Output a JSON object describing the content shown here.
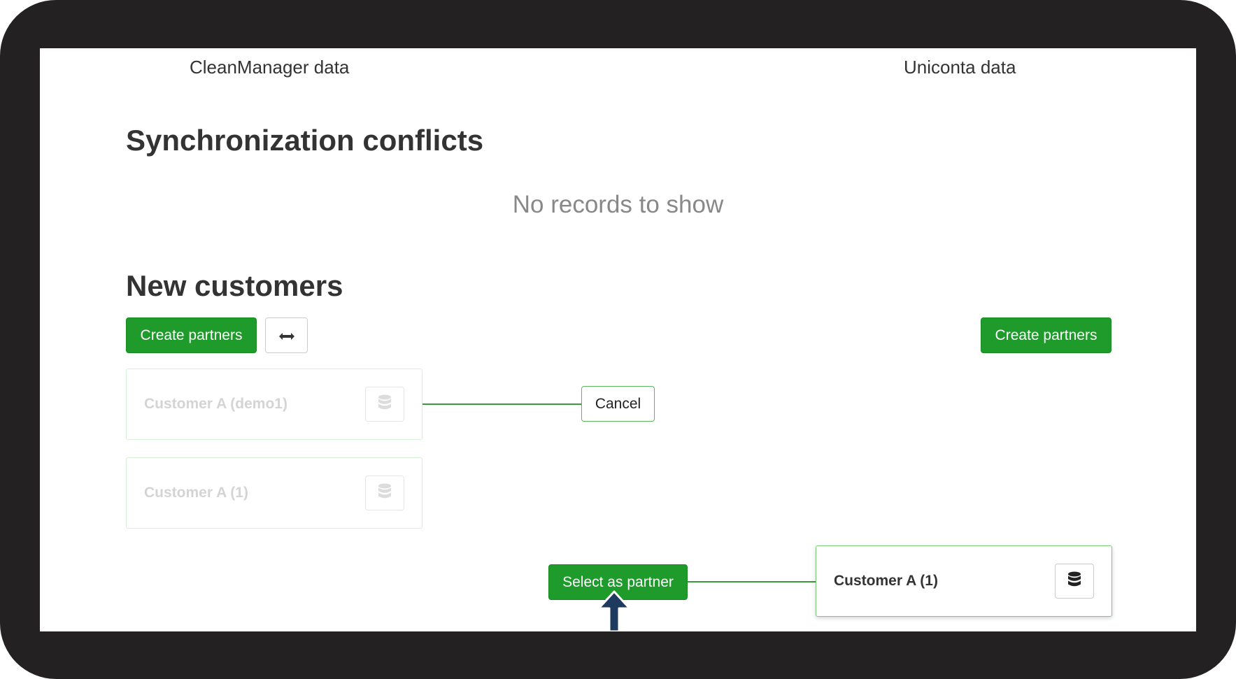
{
  "columns": {
    "left_header": "CleanManager data",
    "right_header": "Uniconta data"
  },
  "conflicts": {
    "title": "Synchronization conflicts",
    "empty_message": "No records to show"
  },
  "new_customers": {
    "title": "New customers",
    "create_partners_left_label": "Create partners",
    "create_partners_right_label": "Create partners",
    "swap_icon": "left-right-arrow-icon",
    "cancel_label": "Cancel",
    "select_partner_label": "Select as partner",
    "left_records": [
      {
        "label": "Customer A (demo1)",
        "icon": "database-icon"
      },
      {
        "label": "Customer A (1)",
        "icon": "database-icon"
      }
    ],
    "right_records": [
      {
        "label": "Customer A (1)",
        "icon": "database-icon"
      }
    ]
  },
  "colors": {
    "primary_green": "#1f9b2b",
    "connector_green": "#3a9a3a",
    "pointer_arrow": "#1f3a5f",
    "frame": "#232122"
  }
}
